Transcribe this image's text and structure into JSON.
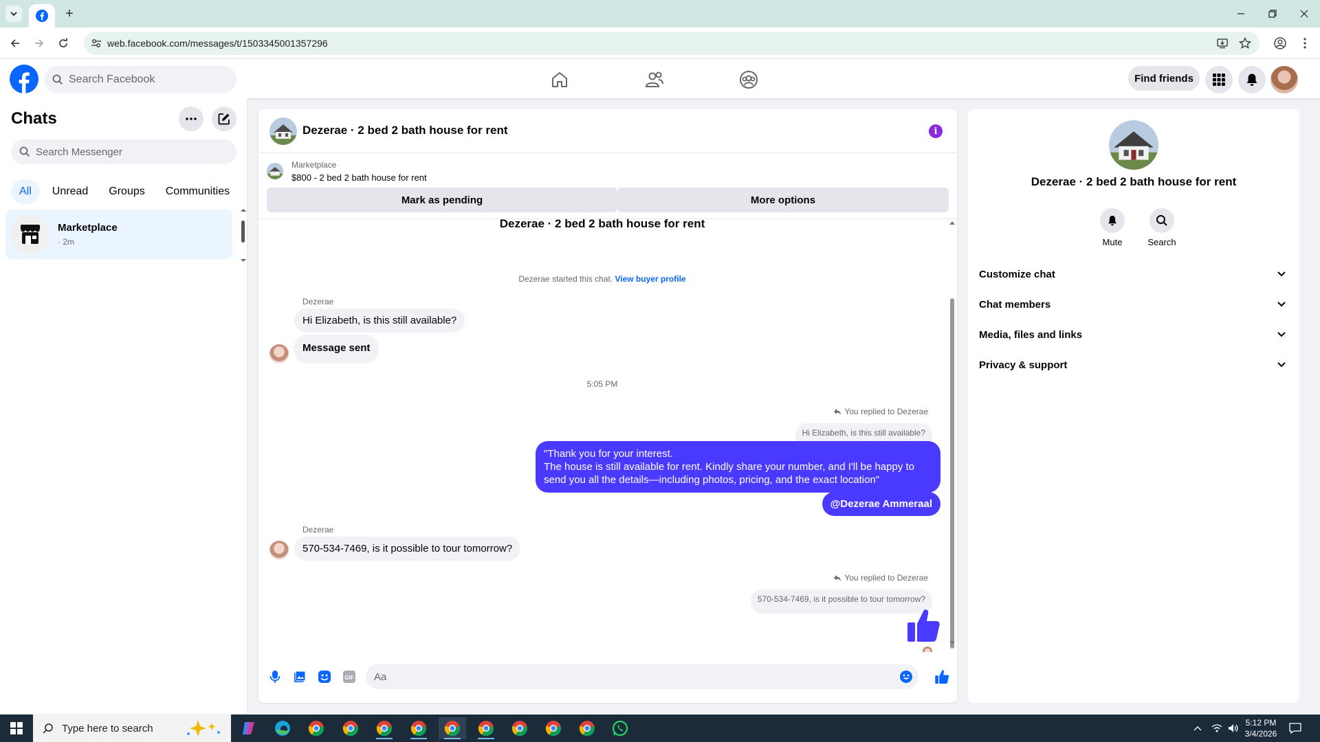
{
  "browser": {
    "url": "web.facebook.com/messages/t/1503345001357296"
  },
  "fb_header": {
    "search_placeholder": "Search Facebook",
    "find_friends": "Find friends"
  },
  "left_panel": {
    "title": "Chats",
    "search_placeholder": "Search Messenger",
    "filters": [
      "All",
      "Unread",
      "Groups",
      "Communities"
    ],
    "chats": [
      {
        "name": "Marketplace",
        "time": "· 2m"
      }
    ]
  },
  "chat": {
    "title": "Dezerae · 2 bed 2 bath house for rent",
    "marketplace_label": "Marketplace",
    "listing": "$800 - 2 bed 2 bath house for rent",
    "mark_pending": "Mark as pending",
    "more_options": "More options",
    "messages": {
      "cut_title": "Dezerae · 2 bed 2 bath house for rent",
      "started_text": "Dezerae started this chat.",
      "view_buyer": "View buyer profile",
      "sender1": "Dezerae",
      "msg1": "Hi Elizabeth, is this still available?",
      "msg2": "Message sent",
      "timestamp": "5:05 PM",
      "replied1": "You replied to Dezerae",
      "quote1": "Hi Elizabeth, is this still available?",
      "out_line1": "\"Thank you for your interest.",
      "out_line2": "The house is still available for rent. Kindly share your number, and I'll be happy to",
      "out_line3": "send you all the details—including photos, pricing, and the exact location\"",
      "mention": "@Dezerae Ammeraal",
      "sender2": "Dezerae",
      "msg3": "570-534-7469, is it possible to tour tomorrow?",
      "replied2": "You replied to Dezerae",
      "quote2": "570-534-7469, is it possible to tour tomorrow?"
    },
    "composer_placeholder": "Aa"
  },
  "right_panel": {
    "title": "Dezerae · 2 bed 2 bath house for rent",
    "mute": "Mute",
    "search": "Search",
    "sections": [
      "Customize chat",
      "Chat members",
      "Media, files and links",
      "Privacy & support"
    ]
  },
  "taskbar": {
    "search_text": "Type here to search",
    "time": "5:12 PM",
    "date": "3/4/2026"
  },
  "colors": {
    "fb_blue": "#0866ff",
    "outgoing_bubble": "#4a3aff",
    "info_purple": "#8a2be2"
  }
}
